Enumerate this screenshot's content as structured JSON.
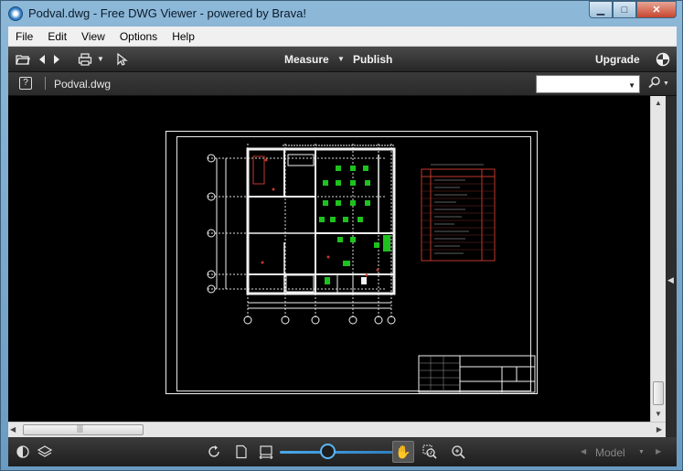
{
  "window": {
    "title": "Podval.dwg - Free DWG Viewer - powered by Brava!",
    "minimize_glyph": "▁",
    "maximize_glyph": "□",
    "close_glyph": "✕"
  },
  "menu": {
    "items": [
      "File",
      "Edit",
      "View",
      "Options",
      "Help"
    ]
  },
  "toolbar": {
    "measure_label": "Measure",
    "publish_label": "Publish",
    "upgrade_label": "Upgrade",
    "icons": [
      "folder-open-icon",
      "back-arrow-icon",
      "forward-arrow-icon",
      "print-icon",
      "select-cursor-icon",
      "brava-logo-icon"
    ]
  },
  "document": {
    "help_glyph": "?",
    "file_name": "Podval.dwg",
    "search_value": ""
  },
  "statusbar": {
    "model_label": "Model",
    "zoom_level": 0.42,
    "icons": [
      "contrast-icon",
      "layers-icon",
      "rotate-icon",
      "page-icon",
      "fit-width-icon",
      "pan-hand-icon",
      "zoom-window-icon",
      "zoom-extents-icon"
    ]
  },
  "colors": {
    "canvas": "#000000",
    "drawing_line": "#f2f2f2",
    "plant_green": "#1ec21e",
    "table_border": "#c0392b",
    "accent_blue": "#4aa8e8"
  }
}
